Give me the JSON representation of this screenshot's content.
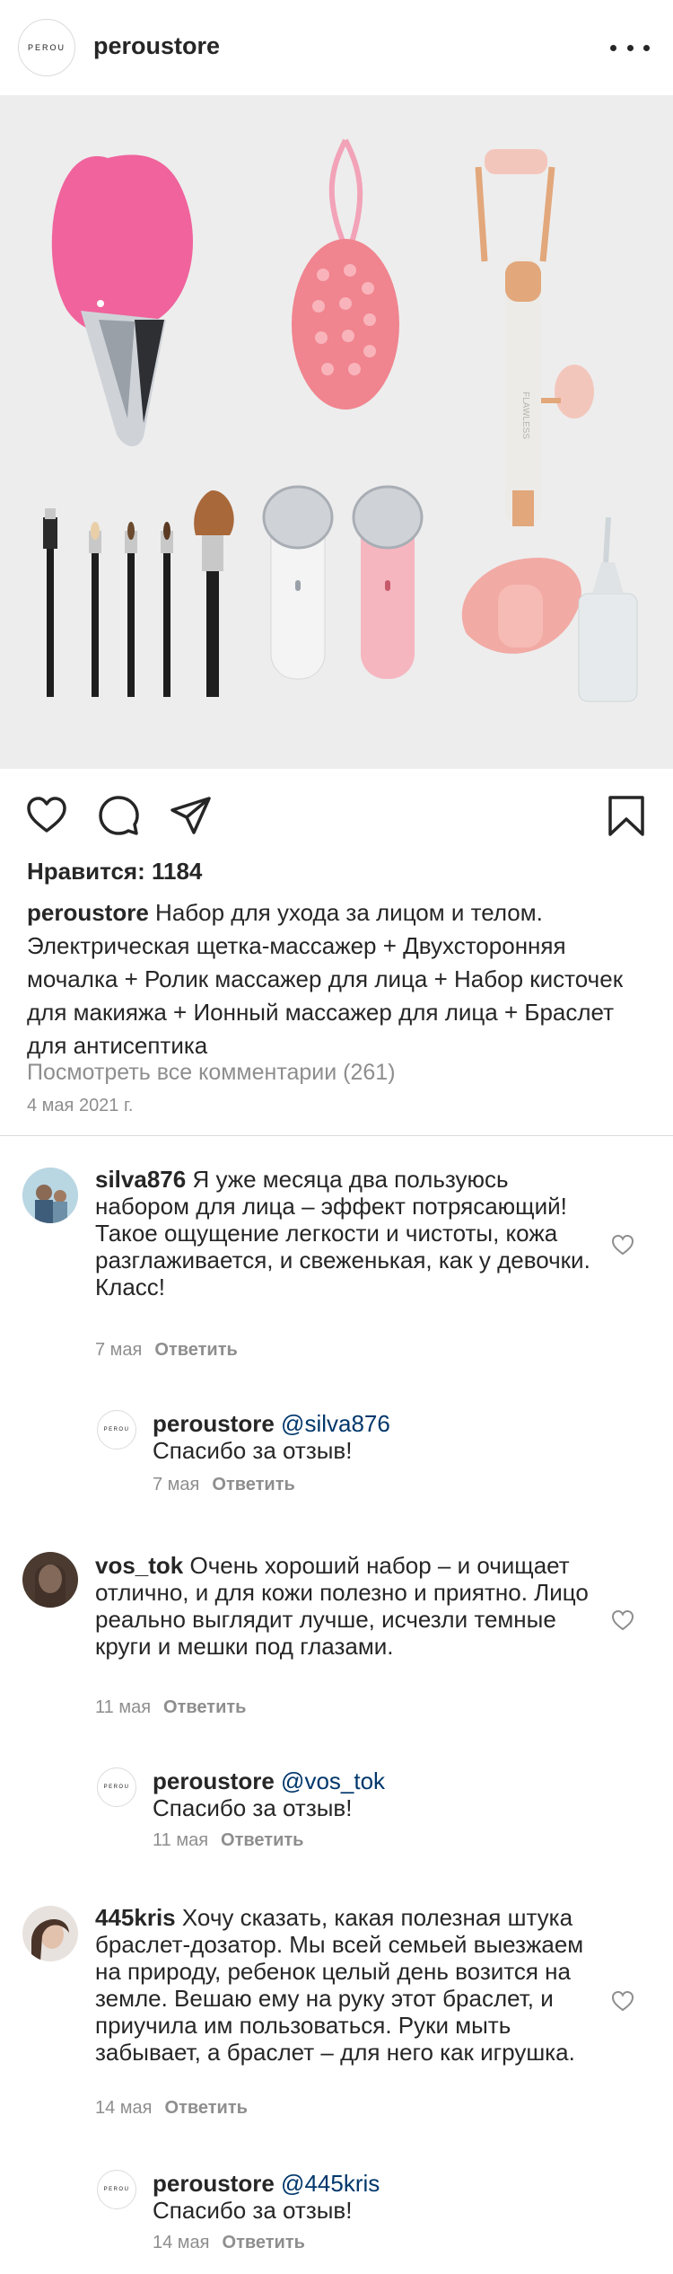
{
  "header": {
    "avatar_text": "PEROU",
    "username": "peroustore"
  },
  "post": {
    "likes": "Нравится: 1184",
    "caption_user": "peroustore",
    "caption_text": " Набор для ухода за лицом и телом. Электрическая щетка-массажер + Двухсторонняя мочалка + Ролик массажер для лица + Набор кисточек для макияжа + Ионный массажер для лица + Браслет для антисептика",
    "view_all": "Посмотреть все комментарии (261)",
    "date": "4 мая 2021 г.",
    "roller_brand": "FLAWLESS"
  },
  "comments": [
    {
      "user": "silva876",
      "text": " Я уже месяца два пользуюсь набором для лица – эффект потрясающий! Такое ощущение легкости и чистоты, кожа разглаживается, и свеженькая, как у девочки. Класс!",
      "time": "7 мая",
      "reply": "Ответить",
      "response": {
        "user": "peroustore",
        "mention": "@silva876",
        "text": "Спасибо за отзыв!",
        "time": "7 мая",
        "reply": "Ответить",
        "avatar_text": "PEROU"
      }
    },
    {
      "user": "vos_tok",
      "text": " Очень хороший набор – и очищает отлично, и для кожи полезно и приятно. Лицо реально выглядит лучше, исчезли темные круги и мешки под глазами.",
      "time": "11 мая",
      "reply": "Ответить",
      "response": {
        "user": "peroustore",
        "mention": "@vos_tok",
        "text": "Спасибо за отзыв!",
        "time": "11 мая",
        "reply": "Ответить",
        "avatar_text": "PEROU"
      }
    },
    {
      "user": "445kris",
      "text": " Хочу сказать, какая полезная штука браслет-дозатор. Мы всей семьей выезжаем на природу, ребенок целый день возится на земле. Вешаю ему на руку этот браслет, и приучила им пользоваться. Руки мыть забывает, а браслет – для него как игрушка.",
      "time": "14 мая",
      "reply": "Ответить",
      "response": {
        "user": "peroustore",
        "mention": "@445kris",
        "text": "Спасибо за отзыв!",
        "time": "14 мая",
        "reply": "Ответить",
        "avatar_text": "PEROU"
      }
    }
  ],
  "colors": {
    "text": "#262626",
    "muted": "#8e8e8e",
    "mention": "#00376b",
    "image_bg": "#ededed",
    "pink": "#f0639c"
  },
  "icons": [
    "more-icon",
    "heart-icon",
    "comment-icon",
    "share-icon",
    "bookmark-icon",
    "comment-like-icon"
  ]
}
